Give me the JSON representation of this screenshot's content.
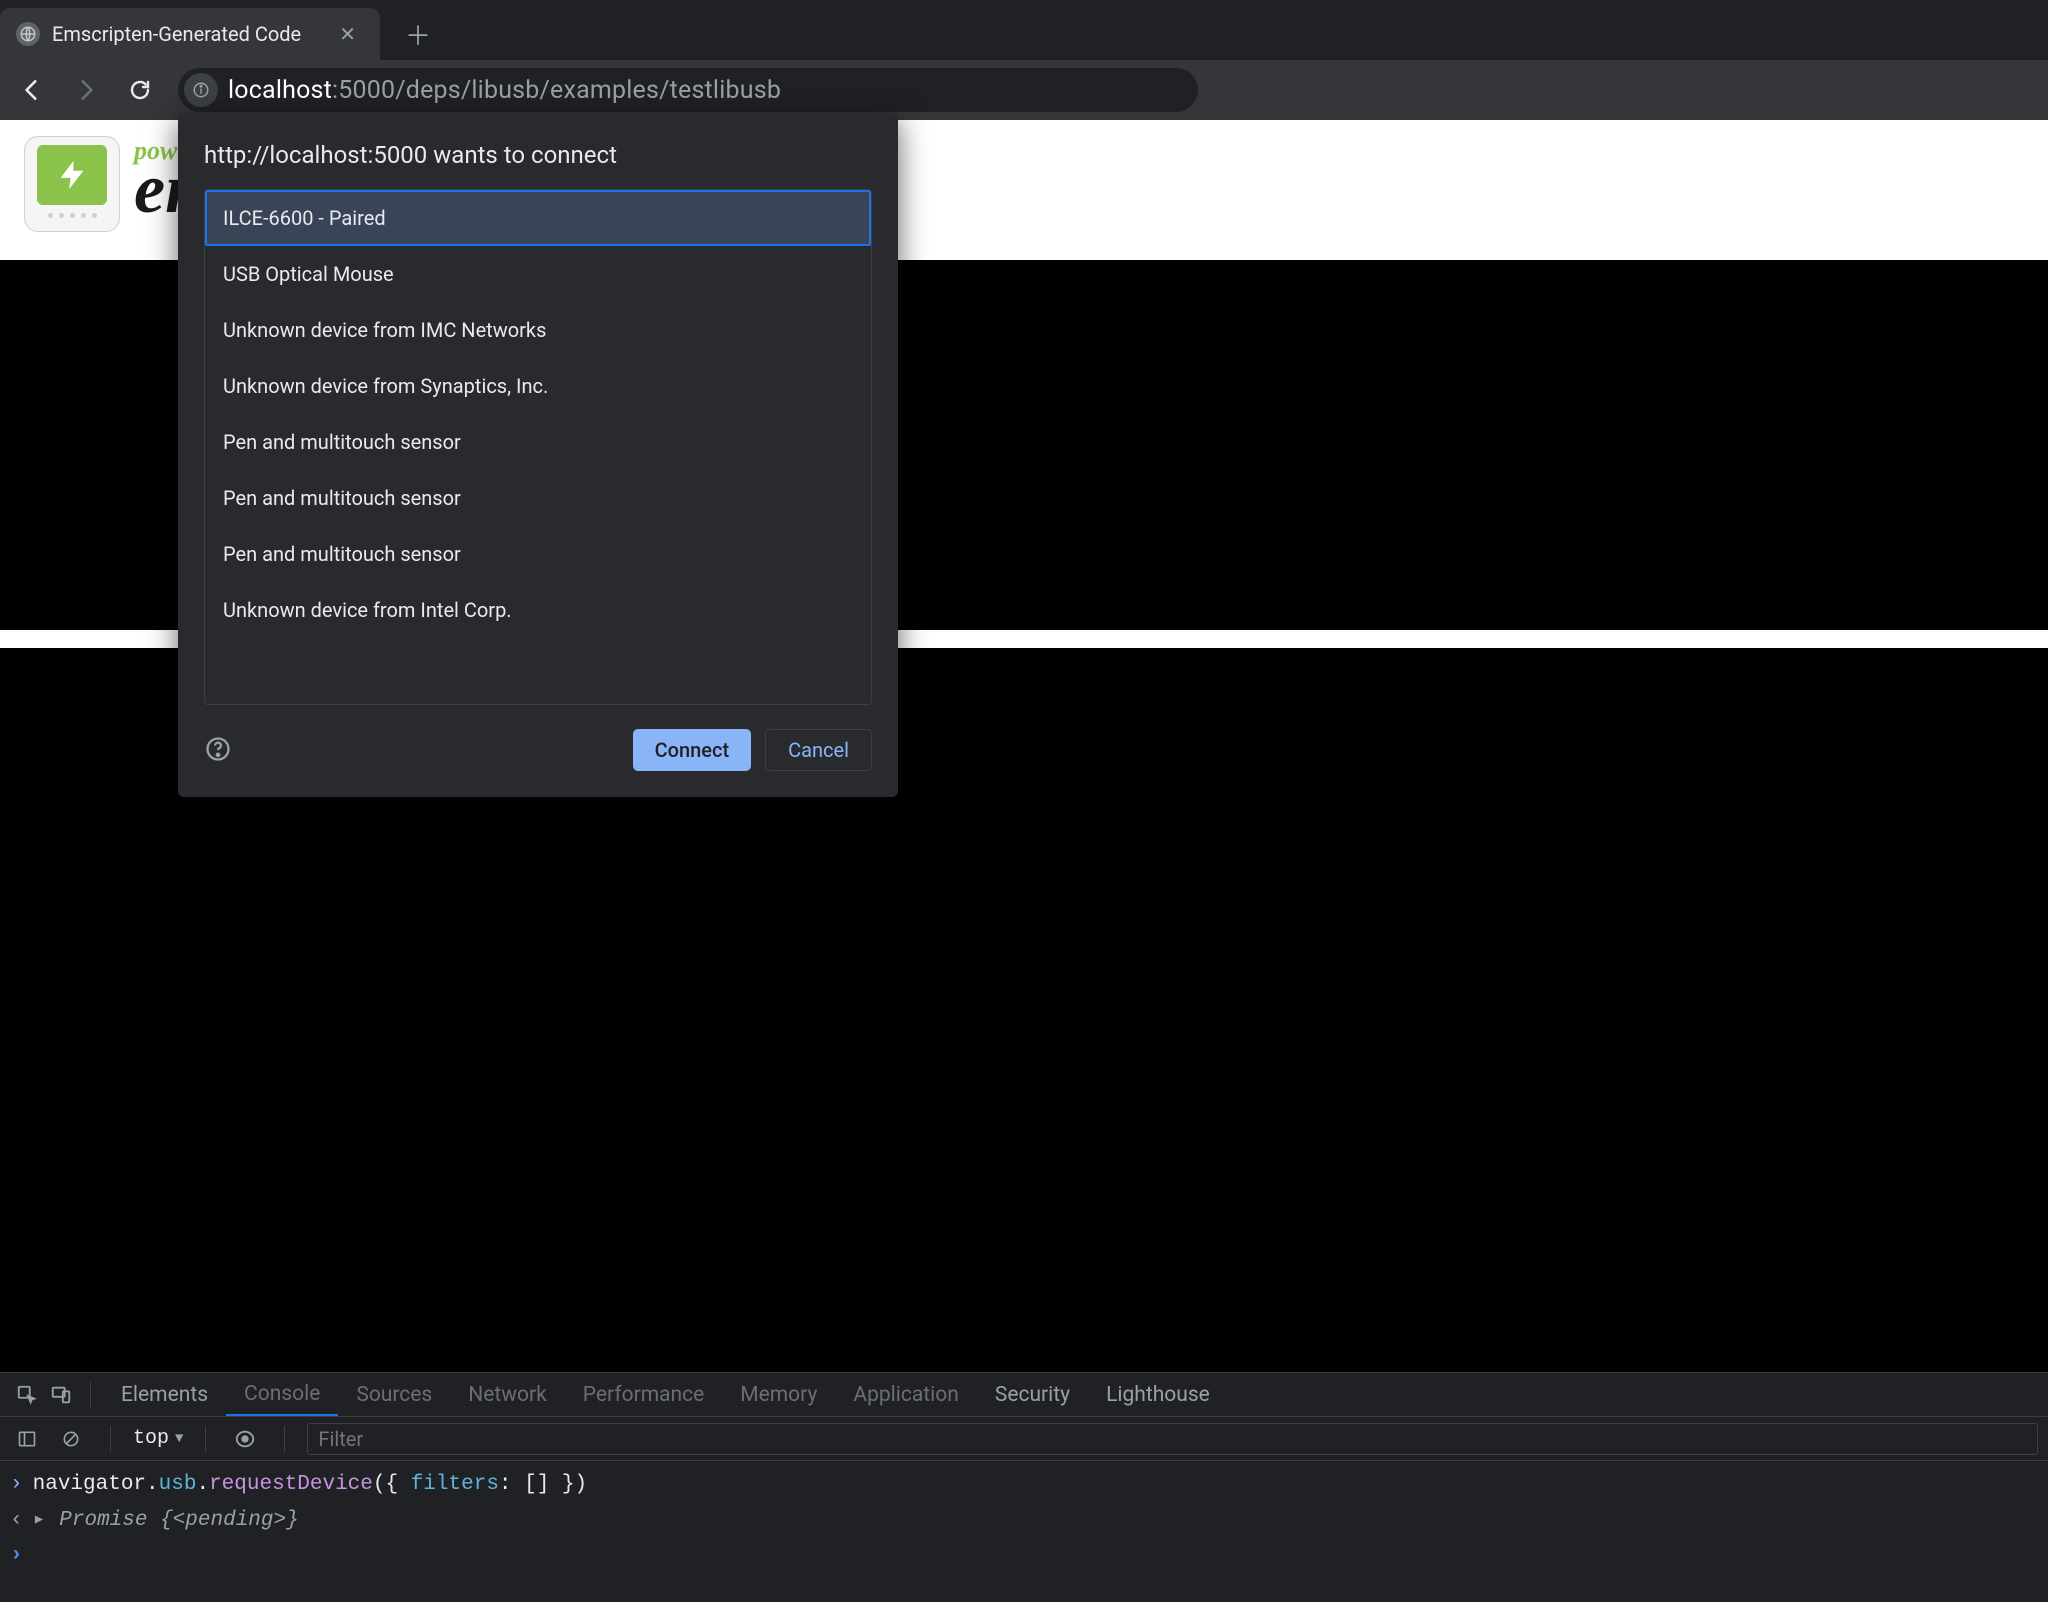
{
  "tab": {
    "title": "Emscripten-Generated Code"
  },
  "address": {
    "host": "localhost",
    "port": ":5000",
    "path": "/deps/libusb/examples/testlibusb"
  },
  "page_brand": {
    "pow": "pow",
    "en": "en"
  },
  "dialog": {
    "title": "http://localhost:5000 wants to connect",
    "devices": [
      "ILCE-6600 - Paired",
      "USB Optical Mouse",
      "Unknown device from IMC Networks",
      "Unknown device from Synaptics, Inc.",
      "Pen and multitouch sensor",
      "Pen and multitouch sensor",
      "Pen and multitouch sensor",
      "Unknown device from Intel Corp."
    ],
    "selected_index": 0,
    "connect": "Connect",
    "cancel": "Cancel"
  },
  "devtools": {
    "tabs": [
      "Elements",
      "Console",
      "Sources",
      "Network",
      "Performance",
      "Memory",
      "Application",
      "Security",
      "Lighthouse"
    ],
    "active_tab_index": 1,
    "context": "top",
    "filter_placeholder": "Filter",
    "lines": {
      "input": "navigator.usb.requestDevice({ filters: [] })",
      "output_prefix": "Promise ",
      "output_state": "{<pending>}"
    }
  }
}
